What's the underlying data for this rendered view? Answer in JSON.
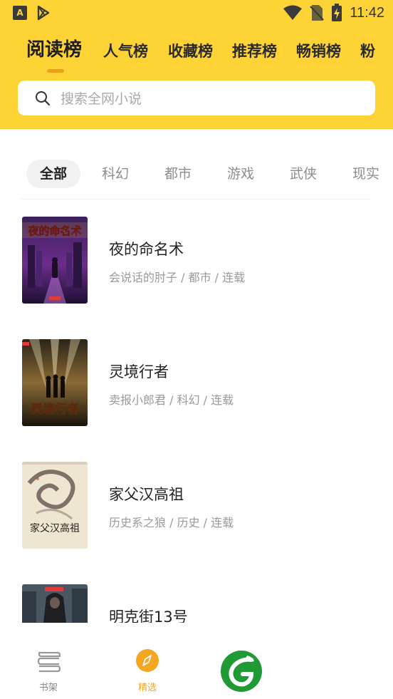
{
  "status_bar": {
    "time": "11:42"
  },
  "top_tabs": [
    "阅读榜",
    "人气榜",
    "收藏榜",
    "推荐榜",
    "畅销榜",
    "粉"
  ],
  "search": {
    "placeholder": "搜索全网小说"
  },
  "categories": [
    "全部",
    "科幻",
    "都市",
    "游戏",
    "武侠",
    "现实"
  ],
  "books": [
    {
      "title": "夜的命名术",
      "meta": "会说话的肘子 / 都市 / 连载",
      "cover_text": "夜的命名术"
    },
    {
      "title": "灵境行者",
      "meta": "卖报小郎君 / 科幻 / 连载",
      "cover_text": "灵境行者"
    },
    {
      "title": "家父汉高祖",
      "meta": "历史系之狼 / 历史 / 连载",
      "cover_text": "家父汉高祖"
    },
    {
      "title": "明克街13号",
      "meta": "",
      "cover_text": ""
    }
  ],
  "bottom_nav": [
    {
      "label": "书架",
      "icon": "bookshelf-icon",
      "active": false
    },
    {
      "label": "精选",
      "icon": "compass-icon",
      "active": true
    },
    {
      "label": "",
      "icon": "app-logo-icon",
      "active": false
    }
  ],
  "colors": {
    "header": "#fdd335",
    "accent": "#f5a623",
    "indicator": "#f09f1c",
    "logo": "#1f9a35"
  }
}
